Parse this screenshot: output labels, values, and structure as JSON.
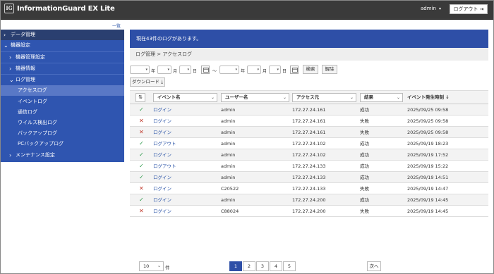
{
  "header": {
    "logo_mark": "IG",
    "logo_text": "InformationGuard EX Lite",
    "user": "admin",
    "logout_label": "ログアウト"
  },
  "top_link": "一覧",
  "sidebar": {
    "items": [
      {
        "label": "データ管理",
        "icon": "chevron-right-icon",
        "level": 0,
        "top": true
      },
      {
        "label": "機器設定",
        "icon": "chevron-down-icon",
        "level": 0
      },
      {
        "label": "機器管理設定",
        "icon": "chevron-right-icon",
        "level": 1
      },
      {
        "label": "機器情報",
        "icon": "chevron-right-icon",
        "level": 1
      },
      {
        "label": "ログ管理",
        "icon": "chevron-down-icon",
        "level": 1
      },
      {
        "label": "アクセスログ",
        "level": 2,
        "active": true
      },
      {
        "label": "イベントログ",
        "level": 2
      },
      {
        "label": "通信ログ",
        "level": 2
      },
      {
        "label": "ウイルス検出ログ",
        "level": 2
      },
      {
        "label": "バックアップログ",
        "level": 2
      },
      {
        "label": "PCバックアップログ",
        "level": 2
      },
      {
        "label": "メンテナンス設定",
        "icon": "chevron-right-icon",
        "level": 1
      }
    ]
  },
  "banner": "現在43件のログがあります。",
  "breadcrumb": "ログ管理 > アクセスログ",
  "filter": {
    "year": "年",
    "month": "月",
    "day": "日",
    "tilde": "～",
    "search_label": "検索",
    "clear_label": "解除",
    "download_label": "ダウンロード"
  },
  "table": {
    "headers": {
      "event": "イベント名",
      "user": "ユーザー名",
      "source": "アクセス元",
      "result": "結果",
      "time": "イベント発生時刻 ↓"
    },
    "rows": [
      {
        "status": "success",
        "mark": "✓",
        "event": "ログイン",
        "user": "admin",
        "source": "172.27.24.161",
        "result": "成功",
        "time": "2025/09/25 09:58"
      },
      {
        "status": "fail",
        "mark": "✕",
        "event": "ログイン",
        "user": "admin",
        "source": "172.27.24.161",
        "result": "失敗",
        "time": "2025/09/25 09:58"
      },
      {
        "status": "fail",
        "mark": "✕",
        "event": "ログイン",
        "user": "admin",
        "source": "172.27.24.161",
        "result": "失敗",
        "time": "2025/09/25 09:58"
      },
      {
        "status": "success",
        "mark": "✓",
        "event": "ログアウト",
        "user": "admin",
        "source": "172.27.24.102",
        "result": "成功",
        "time": "2025/09/19 18:23"
      },
      {
        "status": "success",
        "mark": "✓",
        "event": "ログイン",
        "user": "admin",
        "source": "172.27.24.102",
        "result": "成功",
        "time": "2025/09/19 17:52"
      },
      {
        "status": "success",
        "mark": "✓",
        "event": "ログアウト",
        "user": "admin",
        "source": "172.27.24.133",
        "result": "成功",
        "time": "2025/09/19 15:22"
      },
      {
        "status": "success",
        "mark": "✓",
        "event": "ログイン",
        "user": "admin",
        "source": "172.27.24.133",
        "result": "成功",
        "time": "2025/09/19 14:51"
      },
      {
        "status": "fail",
        "mark": "✕",
        "event": "ログイン",
        "user": "C20522",
        "source": "172.27.24.133",
        "result": "失敗",
        "time": "2025/09/19 14:47"
      },
      {
        "status": "success",
        "mark": "✓",
        "event": "ログイン",
        "user": "admin",
        "source": "172.27.24.200",
        "result": "成功",
        "time": "2025/09/19 14:45"
      },
      {
        "status": "fail",
        "mark": "✕",
        "event": "ログイン",
        "user": "C88024",
        "source": "172.27.24.200",
        "result": "失敗",
        "time": "2025/09/19 14:45"
      }
    ]
  },
  "pagination": {
    "page_size": "10",
    "page_size_unit": "件",
    "pages": [
      "1",
      "2",
      "3",
      "4",
      "5"
    ],
    "current": "1",
    "next_label": "次へ"
  },
  "colors": {
    "header_bg": "#3a3a3a",
    "sidebar_bg": "#2f55b0",
    "accent": "#2e4fa7",
    "success": "#2d9a4a",
    "fail": "#c0392b"
  }
}
